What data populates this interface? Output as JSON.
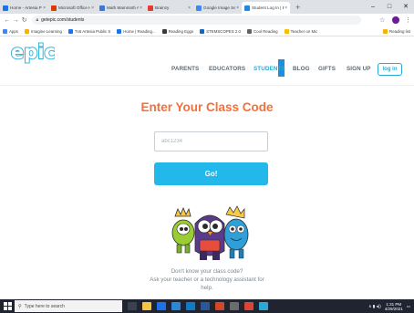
{
  "browser": {
    "tabs": [
      {
        "label": "Home - Artesia Public",
        "color": "#1a73e8"
      },
      {
        "label": "Microsoft Office Ho",
        "color": "#d83b01"
      },
      {
        "label": "Math Mammoth Arit",
        "color": "#3c78d8"
      },
      {
        "label": "Brainzy",
        "color": "#e53935"
      },
      {
        "label": "Google Image Sear",
        "color": "#4285f4"
      },
      {
        "label": "Student Log In | Epic",
        "color": "#1e88e5"
      }
    ],
    "new_tab": "+",
    "window_controls": [
      "–",
      "□",
      "✕"
    ],
    "url": "getepic.com/students",
    "bookmarks": [
      {
        "label": "Apps",
        "color": "#4285f4"
      },
      {
        "label": "Imagine Learning",
        "color": "#f6b400"
      },
      {
        "label": "Tx6 Artesia Public S",
        "color": "#1a73e8"
      },
      {
        "label": "Home | Reading...",
        "color": "#1a73e8"
      },
      {
        "label": "Reading Eggs",
        "color": "#3a3a3a"
      },
      {
        "label": "STEMSCOPES 2.0",
        "color": "#1565c0"
      },
      {
        "label": "Cool Reading",
        "color": "#5f6368"
      },
      {
        "label": "Teacher on Mic",
        "color": "#fbbc04"
      }
    ],
    "other_bookmarks": "Reading list"
  },
  "site": {
    "logo_text": "epic!",
    "nav": {
      "parents": "PARENTS",
      "educators": "EDUCATORS",
      "students": "STUDENTS",
      "blog": "BLOG",
      "gifts": "GIFTS",
      "signup": "SIGN UP",
      "login": "log in"
    },
    "heading": "Enter Your Class Code",
    "input_placeholder": "abc1234",
    "go_label": "Go!",
    "help_line1": "Don't know your class code?",
    "help_line2": "Ask your teacher or a technology assistant for",
    "help_line3": "help."
  },
  "taskbar": {
    "search_placeholder": "Type here to search",
    "time": "1:31 PM",
    "date": "4/29/2021"
  },
  "colors": {
    "accent": "#2aa9d6",
    "heading": "#f4703b",
    "go_button": "#22b9ea",
    "active_nav_highlight": "#1e8fdc"
  }
}
